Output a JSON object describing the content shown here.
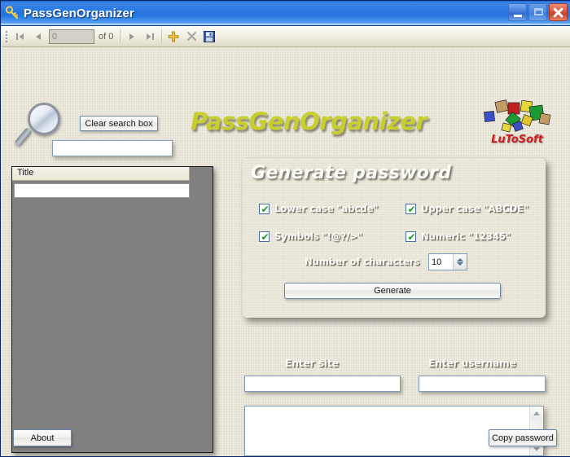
{
  "window": {
    "title": "PassGenOrganizer",
    "icon": "app-key-icon",
    "buttons": {
      "minimize": "minimize-icon",
      "maximize": "maximize-icon",
      "close": "close-icon"
    }
  },
  "toolbar": {
    "first_label": "|◀",
    "prev_label": "◀",
    "record_value": "0",
    "record_placeholder": "0",
    "of_label": "of 0",
    "next_label": "▶",
    "last_label": "▶|",
    "add_label": "+",
    "delete_label": "✕",
    "save_label": "save-icon"
  },
  "search": {
    "magnifier_icon": "magnifier-icon",
    "clear_button": "Clear search box",
    "input_value": "",
    "input_placeholder": ""
  },
  "branding": {
    "logo_text": "PassGenOrganizer",
    "logo_color": "#c8cf2c",
    "company_name": "LuToSoft",
    "company_color": "#cc2222"
  },
  "grid": {
    "column_header": "Title",
    "rows": [
      ""
    ],
    "background_color": "#808080"
  },
  "generate_panel": {
    "title": "Generate password",
    "options": [
      {
        "label": "Lower case \"abcde\"",
        "checked": true
      },
      {
        "label": "Upper case \"ABCDE\"",
        "checked": true
      },
      {
        "label": "Symbols \"!@?/>\"",
        "checked": true
      },
      {
        "label": "Numeric \"12345\"",
        "checked": true
      }
    ],
    "num_chars_label": "Number of characters",
    "num_chars_value": "10",
    "generate_button": "Generate"
  },
  "entry": {
    "site_label": "Enter site",
    "site_value": "",
    "username_label": "Enter username",
    "username_value": "",
    "password_value": ""
  },
  "footer": {
    "about_button": "About",
    "copy_button": "Copy password"
  }
}
